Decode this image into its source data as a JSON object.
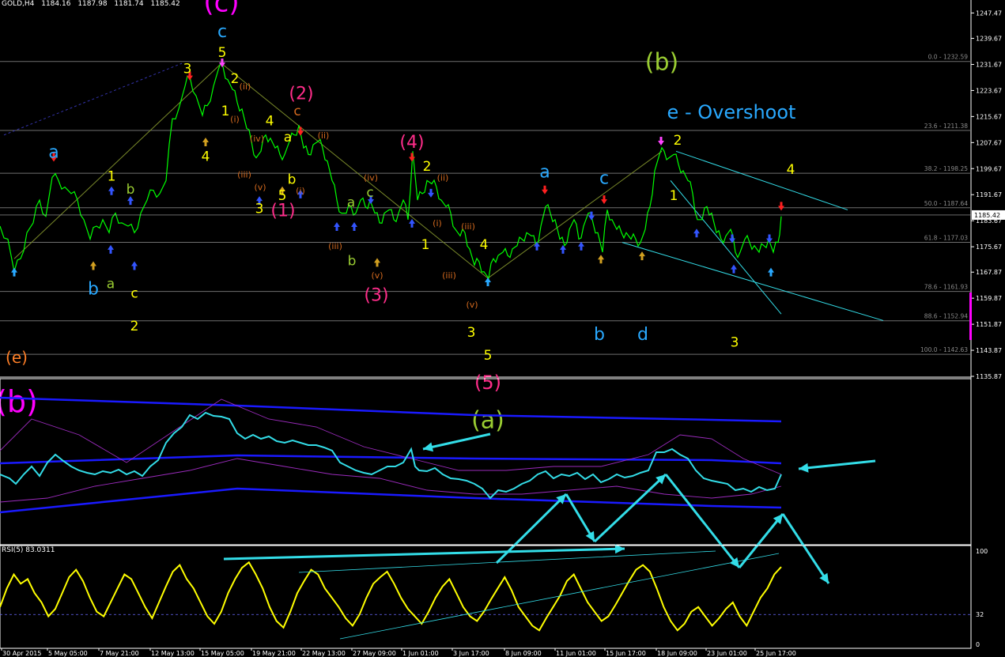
{
  "header": {
    "symbol": "GOLD,H4",
    "open": "1184.16",
    "high": "1187.98",
    "low": "1181.74",
    "close": "1185.42"
  },
  "colors": {
    "background": "#000000",
    "price_line": "#00ff00",
    "wave_yellow": "#ffff00",
    "wave_magenta": "#ff00ff",
    "wave_pink": "#ff2d8a",
    "wave_blue": "#29a9ff",
    "wave_olive": "#9acd32",
    "wave_orange": "#ff7f27",
    "wave_brown": "#d2691e",
    "cyan": "#33dde8",
    "band_blue": "#1a1aff",
    "rsi": "#ffff00"
  },
  "chart_data": [
    {
      "type": "line",
      "name": "price",
      "ylim": [
        1135.87,
        1250.0
      ],
      "y_ticks": [
        "1247.47",
        "1239.67",
        "1231.67",
        "1223.67",
        "1215.67",
        "1207.67",
        "1199.67",
        "1191.67",
        "1183.67",
        "1175.67",
        "1167.87",
        "1159.87",
        "1151.87",
        "1143.87",
        "1135.87"
      ],
      "current_price_tag": "1185.42",
      "price_path": [
        [
          0,
          1182
        ],
        [
          10,
          1178
        ],
        [
          18,
          1168
        ],
        [
          26,
          1172
        ],
        [
          34,
          1180
        ],
        [
          42,
          1183
        ],
        [
          50,
          1190
        ],
        [
          58,
          1185
        ],
        [
          66,
          1197
        ],
        [
          74,
          1196
        ],
        [
          82,
          1194
        ],
        [
          90,
          1192
        ],
        [
          98,
          1190
        ],
        [
          106,
          1184
        ],
        [
          114,
          1178
        ],
        [
          122,
          1182
        ],
        [
          130,
          1184
        ],
        [
          138,
          1180
        ],
        [
          146,
          1186
        ],
        [
          154,
          1183
        ],
        [
          162,
          1182
        ],
        [
          170,
          1180
        ],
        [
          178,
          1186
        ],
        [
          186,
          1190
        ],
        [
          194,
          1193
        ],
        [
          202,
          1192
        ],
        [
          210,
          1196
        ],
        [
          218,
          1215
        ],
        [
          226,
          1218
        ],
        [
          234,
          1225
        ],
        [
          240,
          1228
        ],
        [
          248,
          1222
        ],
        [
          256,
          1216
        ],
        [
          262,
          1219
        ],
        [
          270,
          1225
        ],
        [
          276,
          1230
        ],
        [
          282,
          1231
        ],
        [
          288,
          1227
        ],
        [
          294,
          1224
        ],
        [
          300,
          1220
        ],
        [
          306,
          1218
        ],
        [
          312,
          1212
        ],
        [
          318,
          1208
        ],
        [
          324,
          1203
        ],
        [
          330,
          1205
        ],
        [
          336,
          1210
        ],
        [
          342,
          1209
        ],
        [
          348,
          1206
        ],
        [
          354,
          1204
        ],
        [
          360,
          1204
        ],
        [
          366,
          1208
        ],
        [
          372,
          1210
        ],
        [
          378,
          1213
        ],
        [
          384,
          1206
        ],
        [
          390,
          1204
        ],
        [
          396,
          1207
        ],
        [
          402,
          1208
        ],
        [
          408,
          1206
        ],
        [
          414,
          1202
        ],
        [
          420,
          1196
        ],
        [
          426,
          1190
        ],
        [
          432,
          1186
        ],
        [
          438,
          1186
        ],
        [
          444,
          1188
        ],
        [
          450,
          1186
        ],
        [
          456,
          1190
        ],
        [
          462,
          1188
        ],
        [
          468,
          1190
        ],
        [
          474,
          1186
        ],
        [
          480,
          1183
        ],
        [
          486,
          1186
        ],
        [
          492,
          1187
        ],
        [
          498,
          1184
        ],
        [
          504,
          1186
        ],
        [
          510,
          1190
        ],
        [
          516,
          1184
        ],
        [
          522,
          1205
        ],
        [
          528,
          1190
        ],
        [
          534,
          1192
        ],
        [
          540,
          1196
        ],
        [
          546,
          1195
        ],
        [
          552,
          1194
        ],
        [
          558,
          1190
        ],
        [
          564,
          1188
        ],
        [
          570,
          1186
        ],
        [
          576,
          1181
        ],
        [
          582,
          1179
        ],
        [
          588,
          1180
        ],
        [
          594,
          1175
        ],
        [
          600,
          1170
        ],
        [
          606,
          1171
        ],
        [
          612,
          1168
        ],
        [
          618,
          1166
        ],
        [
          624,
          1172
        ],
        [
          630,
          1173
        ],
        [
          636,
          1174
        ],
        [
          642,
          1173
        ],
        [
          648,
          1175
        ],
        [
          654,
          1176
        ],
        [
          660,
          1178
        ],
        [
          666,
          1180
        ],
        [
          672,
          1179
        ],
        [
          678,
          1176
        ],
        [
          684,
          1182
        ],
        [
          690,
          1188
        ],
        [
          696,
          1186
        ],
        [
          702,
          1184
        ],
        [
          708,
          1178
        ],
        [
          714,
          1176
        ],
        [
          720,
          1181
        ],
        [
          726,
          1184
        ],
        [
          732,
          1178
        ],
        [
          738,
          1182
        ],
        [
          744,
          1186
        ],
        [
          750,
          1183
        ],
        [
          756,
          1180
        ],
        [
          762,
          1174
        ],
        [
          768,
          1187
        ],
        [
          774,
          1184
        ],
        [
          780,
          1181
        ],
        [
          786,
          1180
        ],
        [
          792,
          1180
        ],
        [
          798,
          1178
        ],
        [
          804,
          1178
        ],
        [
          810,
          1177
        ],
        [
          816,
          1181
        ],
        [
          822,
          1188
        ],
        [
          828,
          1199
        ],
        [
          834,
          1204
        ],
        [
          840,
          1205
        ],
        [
          846,
          1203
        ],
        [
          852,
          1204
        ],
        [
          858,
          1201
        ],
        [
          864,
          1199
        ],
        [
          870,
          1196
        ],
        [
          876,
          1192
        ],
        [
          882,
          1184
        ],
        [
          888,
          1184
        ],
        [
          894,
          1188
        ],
        [
          900,
          1186
        ],
        [
          906,
          1180
        ],
        [
          912,
          1178
        ],
        [
          918,
          1179
        ],
        [
          924,
          1181
        ],
        [
          930,
          1174
        ],
        [
          936,
          1174
        ],
        [
          942,
          1178
        ],
        [
          948,
          1177
        ],
        [
          954,
          1176
        ],
        [
          960,
          1174
        ],
        [
          966,
          1176
        ],
        [
          972,
          1178
        ],
        [
          978,
          1174
        ],
        [
          984,
          1177
        ],
        [
          988,
          1185
        ]
      ],
      "fibonacci_levels": [
        {
          "label": "0.0 - 1232.59",
          "value": 1232.59
        },
        {
          "label": "23.6 - 1211.38",
          "value": 1211.38
        },
        {
          "label": "38.2 - 1198.25",
          "value": 1198.25
        },
        {
          "label": "50.0 - 1187.64",
          "value": 1187.64
        },
        {
          "label": "61.8 - 1177.03",
          "value": 1177.03
        },
        {
          "label": "78.6 - 1161.93",
          "value": 1161.93
        },
        {
          "label": "88.6 - 1152.94",
          "value": 1152.94
        },
        {
          "label": "100.0 - 1142.63",
          "value": 1142.63
        }
      ],
      "wave_labels": [
        {
          "text": "(c)",
          "color": "wave_magenta",
          "x": 280,
          "y": 1248
        },
        {
          "text": "c",
          "color": "wave_blue",
          "x": 281,
          "y": 1240
        },
        {
          "text": "5",
          "color": "wave_yellow",
          "x": 281,
          "y": 1234
        },
        {
          "text": "3",
          "color": "wave_yellow",
          "x": 237,
          "y": 1229
        },
        {
          "text": "2",
          "color": "wave_yellow",
          "x": 297,
          "y": 1226
        },
        {
          "text": "(ii)",
          "color": "wave_brown",
          "x": 310,
          "y": 1224
        },
        {
          "text": "1",
          "color": "wave_yellow",
          "x": 285,
          "y": 1216
        },
        {
          "text": "(i)",
          "color": "wave_brown",
          "x": 297,
          "y": 1214
        },
        {
          "text": "4",
          "color": "wave_yellow",
          "x": 260,
          "y": 1202
        },
        {
          "text": "4",
          "color": "wave_yellow",
          "x": 341,
          "y": 1213
        },
        {
          "text": "(iv)",
          "color": "wave_brown",
          "x": 325,
          "y": 1208
        },
        {
          "text": "a",
          "color": "wave_yellow",
          "x": 364,
          "y": 1208
        },
        {
          "text": "(iii)",
          "color": "wave_brown",
          "x": 309,
          "y": 1197
        },
        {
          "text": "(v)",
          "color": "wave_brown",
          "x": 329,
          "y": 1193
        },
        {
          "text": "b",
          "color": "wave_yellow",
          "x": 369,
          "y": 1195
        },
        {
          "text": "(i)",
          "color": "wave_brown",
          "x": 380,
          "y": 1192
        },
        {
          "text": "3",
          "color": "wave_yellow",
          "x": 328,
          "y": 1186
        },
        {
          "text": "5",
          "color": "wave_yellow",
          "x": 357,
          "y": 1190
        },
        {
          "text": "(1)",
          "color": "wave_pink",
          "x": 358,
          "y": 1185
        },
        {
          "text": "(2)",
          "color": "wave_pink",
          "x": 381,
          "y": 1221
        },
        {
          "text": "c",
          "color": "wave_brown",
          "x": 376,
          "y": 1216
        },
        {
          "text": "(ii)",
          "color": "wave_brown",
          "x": 409,
          "y": 1209
        },
        {
          "text": "(4)",
          "color": "wave_pink",
          "x": 521,
          "y": 1206
        },
        {
          "text": "2",
          "color": "wave_yellow",
          "x": 540,
          "y": 1199
        },
        {
          "text": "(ii)",
          "color": "wave_brown",
          "x": 560,
          "y": 1196
        },
        {
          "text": "(iv)",
          "color": "wave_brown",
          "x": 469,
          "y": 1196
        },
        {
          "text": "a",
          "color": "wave_olive",
          "x": 444,
          "y": 1188
        },
        {
          "text": "c",
          "color": "wave_olive",
          "x": 468,
          "y": 1191
        },
        {
          "text": "(iii)",
          "color": "wave_brown",
          "x": 592,
          "y": 1181
        },
        {
          "text": "(i)",
          "color": "wave_brown",
          "x": 553,
          "y": 1182
        },
        {
          "text": "(iii)",
          "color": "wave_brown",
          "x": 424,
          "y": 1175
        },
        {
          "text": "b",
          "color": "wave_olive",
          "x": 445,
          "y": 1170
        },
        {
          "text": "(v)",
          "color": "wave_brown",
          "x": 477,
          "y": 1166
        },
        {
          "text": "1",
          "color": "wave_yellow",
          "x": 538,
          "y": 1175
        },
        {
          "text": "4",
          "color": "wave_yellow",
          "x": 612,
          "y": 1175
        },
        {
          "text": "(3)",
          "color": "wave_pink",
          "x": 476,
          "y": 1159
        },
        {
          "text": "(iii)",
          "color": "wave_brown",
          "x": 568,
          "y": 1166
        },
        {
          "text": "(v)",
          "color": "wave_brown",
          "x": 597,
          "y": 1157
        },
        {
          "text": "3",
          "color": "wave_yellow",
          "x": 596,
          "y": 1148
        },
        {
          "text": "5",
          "color": "wave_yellow",
          "x": 617,
          "y": 1141
        },
        {
          "text": "(5)",
          "color": "wave_pink",
          "x": 617,
          "y": 1132
        },
        {
          "text": "(a)",
          "color": "wave_olive",
          "x": 617,
          "y": 1120
        },
        {
          "text": "a",
          "color": "wave_blue",
          "x": 68,
          "y": 1203
        },
        {
          "text": "1",
          "color": "wave_yellow",
          "x": 141,
          "y": 1196
        },
        {
          "text": "b",
          "color": "wave_olive",
          "x": 165,
          "y": 1192
        },
        {
          "text": "b",
          "color": "wave_blue",
          "x": 118,
          "y": 1161
        },
        {
          "text": "a",
          "color": "wave_olive",
          "x": 140,
          "y": 1163
        },
        {
          "text": "c",
          "color": "wave_yellow",
          "x": 170,
          "y": 1160
        },
        {
          "text": "2",
          "color": "wave_yellow",
          "x": 170,
          "y": 1150
        },
        {
          "text": "(e)",
          "color": "wave_orange",
          "x": 21,
          "y": 1140
        },
        {
          "text": "(b)",
          "color": "wave_magenta",
          "x": 21,
          "y": 1125
        },
        {
          "text": "a",
          "color": "wave_blue",
          "x": 689,
          "y": 1197
        },
        {
          "text": "c",
          "color": "wave_blue",
          "x": 764,
          "y": 1195
        },
        {
          "text": "b",
          "color": "wave_blue",
          "x": 758,
          "y": 1147
        },
        {
          "text": "d",
          "color": "wave_blue",
          "x": 813,
          "y": 1147
        },
        {
          "text": "(b)",
          "color": "wave_olive",
          "x": 837,
          "y": 1230
        },
        {
          "text": "e - Overshoot",
          "color": "wave_blue",
          "x": 925,
          "y": 1215
        },
        {
          "text": "2",
          "color": "wave_yellow",
          "x": 857,
          "y": 1207
        },
        {
          "text": "1",
          "color": "wave_yellow",
          "x": 852,
          "y": 1190
        },
        {
          "text": "4",
          "color": "wave_yellow",
          "x": 1000,
          "y": 1198
        },
        {
          "text": "3",
          "color": "wave_yellow",
          "x": 929,
          "y": 1145
        }
      ],
      "trend_lines": [
        {
          "color": "cyan",
          "points": [
            [
              855,
              1205
            ],
            [
              1072,
              1187
            ]
          ]
        },
        {
          "color": "cyan",
          "points": [
            [
              787,
              1177
            ],
            [
              1117,
              1153
            ]
          ]
        },
        {
          "color": "cyan",
          "points": [
            [
              848,
              1196
            ],
            [
              988,
              1155
            ]
          ]
        },
        {
          "color": "olive",
          "points": [
            [
              18,
              1172
            ],
            [
              280,
              1232
            ]
          ]
        },
        {
          "color": "olive",
          "points": [
            [
              280,
              1232
            ],
            [
              617,
              1166
            ]
          ]
        },
        {
          "color": "olive",
          "points": [
            [
              617,
              1166
            ],
            [
              837,
              1205
            ]
          ]
        }
      ]
    },
    {
      "type": "line",
      "name": "indicator",
      "bands": "blue envelope lines with magenta bollinger bands"
    },
    {
      "type": "line",
      "name": "RSI(5)",
      "header": "RSI(5) 83.0311",
      "ylim": [
        0,
        100
      ],
      "y_ticks": [
        "100",
        "32",
        "0"
      ],
      "level": 32
    }
  ],
  "x_axis_labels": [
    "30 Apr 2015",
    "5 May 05:00",
    "7 May 21:00",
    "12 May 13:00",
    "15 May 05:00",
    "19 May 21:00",
    "22 May 13:00",
    "27 May 09:00",
    "1 Jun 01:00",
    "3 Jun 17:00",
    "8 Jun 09:00",
    "11 Jun 01:00",
    "15 Jun 17:00",
    "18 Jun 09:00",
    "23 Jun 01:00",
    "25 Jun 17:00"
  ]
}
